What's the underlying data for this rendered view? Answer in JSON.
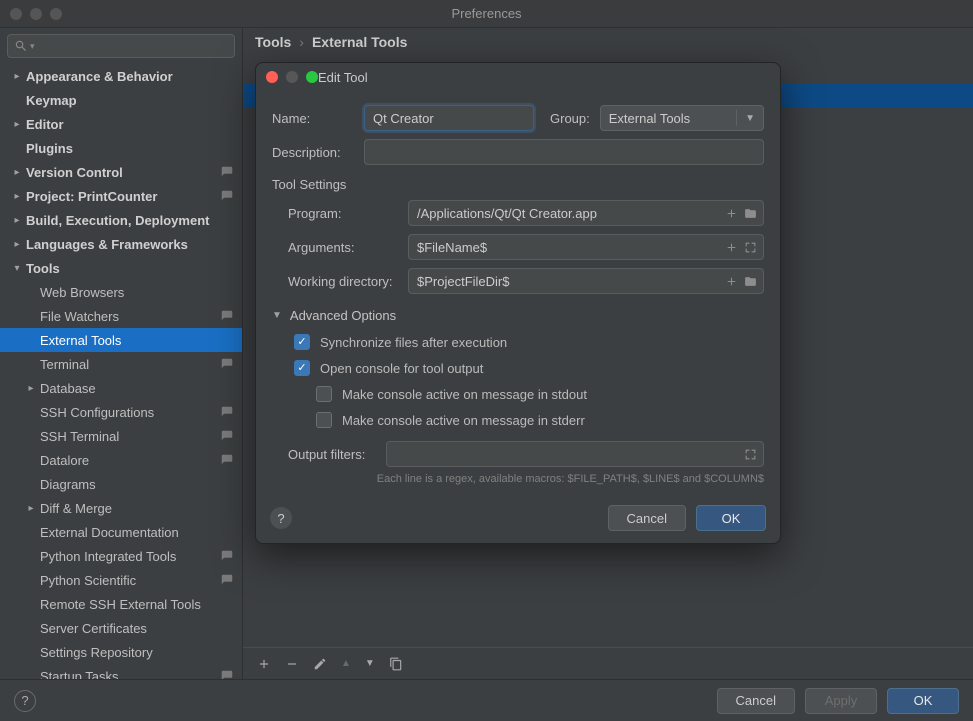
{
  "window": {
    "title": "Preferences"
  },
  "breadcrumb": {
    "root": "Tools",
    "leaf": "External Tools",
    "sep": "›"
  },
  "sidebar": {
    "items": [
      {
        "label": "Appearance & Behavior",
        "arrow": ">",
        "bold": true,
        "depth": 0
      },
      {
        "label": "Keymap",
        "arrow": "",
        "bold": true,
        "depth": 0
      },
      {
        "label": "Editor",
        "arrow": ">",
        "bold": true,
        "depth": 0
      },
      {
        "label": "Plugins",
        "arrow": "",
        "bold": true,
        "depth": 0
      },
      {
        "label": "Version Control",
        "arrow": ">",
        "bold": true,
        "depth": 0,
        "badge": true
      },
      {
        "label": "Project: PrintCounter",
        "arrow": ">",
        "bold": true,
        "depth": 0,
        "badge": true
      },
      {
        "label": "Build, Execution, Deployment",
        "arrow": ">",
        "bold": true,
        "depth": 0
      },
      {
        "label": "Languages & Frameworks",
        "arrow": ">",
        "bold": true,
        "depth": 0
      },
      {
        "label": "Tools",
        "arrow": "v",
        "bold": true,
        "depth": 0
      },
      {
        "label": "Web Browsers",
        "arrow": "",
        "depth": 1
      },
      {
        "label": "File Watchers",
        "arrow": "",
        "depth": 1,
        "badge": true
      },
      {
        "label": "External Tools",
        "arrow": "",
        "depth": 1,
        "selected": true
      },
      {
        "label": "Terminal",
        "arrow": "",
        "depth": 1,
        "badge": true
      },
      {
        "label": "Database",
        "arrow": ">",
        "depth": 1,
        "hasArrow": true
      },
      {
        "label": "SSH Configurations",
        "arrow": "",
        "depth": 1,
        "badge": true
      },
      {
        "label": "SSH Terminal",
        "arrow": "",
        "depth": 1,
        "badge": true
      },
      {
        "label": "Datalore",
        "arrow": "",
        "depth": 1,
        "badge": true
      },
      {
        "label": "Diagrams",
        "arrow": "",
        "depth": 1
      },
      {
        "label": "Diff & Merge",
        "arrow": ">",
        "depth": 1,
        "hasArrow": true
      },
      {
        "label": "External Documentation",
        "arrow": "",
        "depth": 1
      },
      {
        "label": "Python Integrated Tools",
        "arrow": "",
        "depth": 1,
        "badge": true
      },
      {
        "label": "Python Scientific",
        "arrow": "",
        "depth": 1,
        "badge": true
      },
      {
        "label": "Remote SSH External Tools",
        "arrow": "",
        "depth": 1
      },
      {
        "label": "Server Certificates",
        "arrow": "",
        "depth": 1
      },
      {
        "label": "Settings Repository",
        "arrow": "",
        "depth": 1
      },
      {
        "label": "Startup Tasks",
        "arrow": "",
        "depth": 1,
        "badge": true
      }
    ]
  },
  "footer": {
    "cancel": "Cancel",
    "apply": "Apply",
    "ok": "OK"
  },
  "modal": {
    "title": "Edit Tool",
    "name_label": "Name:",
    "name_value": "Qt Creator",
    "group_label": "Group:",
    "group_value": "External Tools",
    "desc_label": "Description:",
    "desc_value": "",
    "toolsettings_header": "Tool Settings",
    "program_label": "Program:",
    "program_value": "/Applications/Qt/Qt Creator.app",
    "arguments_label": "Arguments:",
    "arguments_value": "$FileName$",
    "wd_label": "Working directory:",
    "wd_value": "$ProjectFileDir$",
    "adv_header": "Advanced Options",
    "adv": {
      "sync": "Synchronize files after execution",
      "open_console": "Open console for tool output",
      "active_stdout": "Make console active on message in stdout",
      "active_stderr": "Make console active on message in stderr"
    },
    "filters_label": "Output filters:",
    "filters_value": "",
    "hint": "Each line is a regex, available macros: $FILE_PATH$, $LINE$ and $COLUMN$",
    "cancel": "Cancel",
    "ok": "OK"
  }
}
